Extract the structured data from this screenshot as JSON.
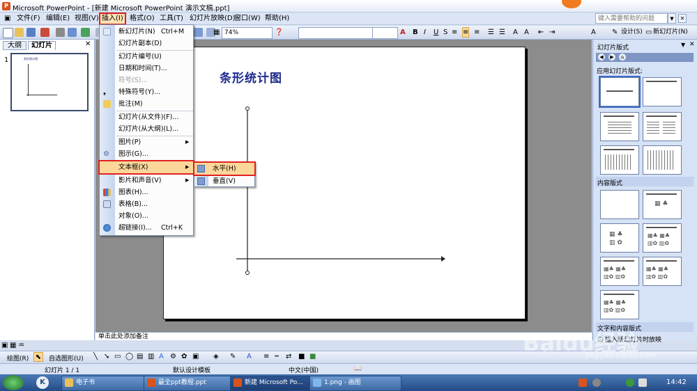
{
  "window": {
    "title": "Microsoft PowerPoint - [新建 Microsoft PowerPoint 演示文稿.ppt]"
  },
  "menubar": {
    "items": [
      "文件(F)",
      "编辑(E)",
      "视图(V)",
      "插入(I)",
      "格式(O)",
      "工具(T)",
      "幻灯片放映(D)",
      "窗口(W)",
      "帮助(H)"
    ],
    "help_placeholder": "键入需要帮助的问题"
  },
  "toolbar": {
    "zoom": "74%",
    "design_label": "设计(S)",
    "new_slide_label": "新幻灯片(N)"
  },
  "left_panel": {
    "tabs": [
      "大纲",
      "幻灯片"
    ],
    "slide_number": "1"
  },
  "slide": {
    "title": "条形统计图"
  },
  "notes": {
    "placeholder": "单击此处添加备注"
  },
  "insert_menu": {
    "items": [
      {
        "label": "新幻灯片(N)",
        "shortcut": "Ctrl+M"
      },
      {
        "label": "幻灯片副本(D)"
      },
      {
        "label": "幻灯片编号(U)"
      },
      {
        "label": "日期和时间(T)..."
      },
      {
        "label": "符号(S)...",
        "disabled": true
      },
      {
        "label": "特殊符号(Y)..."
      },
      {
        "label": "批注(M)"
      },
      {
        "label": "幻灯片(从文件)(F)..."
      },
      {
        "label": "幻灯片(从大纲)(L)..."
      },
      {
        "label": "图片(P)",
        "submenu": true
      },
      {
        "label": "图示(G)..."
      },
      {
        "label": "文本框(X)",
        "submenu": true,
        "highlighted": true
      },
      {
        "label": "影片和声音(V)",
        "submenu": true
      },
      {
        "label": "图表(H)..."
      },
      {
        "label": "表格(B)..."
      },
      {
        "label": "对象(O)..."
      },
      {
        "label": "超链接(I)...",
        "shortcut": "Ctrl+K"
      }
    ]
  },
  "textbox_submenu": {
    "items": [
      "水平(H)",
      "垂直(V)"
    ]
  },
  "task_pane": {
    "title": "幻灯片版式",
    "apply_label": "应用幻灯片版式:",
    "section_content": "内容版式",
    "section_text_content": "文字和内容版式",
    "footer_checkbox": "插入新幻灯片时放映"
  },
  "drawing_toolbar": {
    "draw_label": "绘图(R)",
    "autoshapes_label": "自选图形(U)"
  },
  "status_bar": {
    "slide_info": "幻灯片 1 / 1",
    "template": "默认设计模板",
    "language": "中文(中国)"
  },
  "taskbar": {
    "buttons": [
      "电子书",
      "最全ppt教程.ppt",
      "新建 Microsoft Po...",
      "1.png - 画图"
    ],
    "clock": "14:42"
  },
  "watermark": {
    "text": "Baidu经验",
    "sub": "jingyan.baidu.com"
  }
}
